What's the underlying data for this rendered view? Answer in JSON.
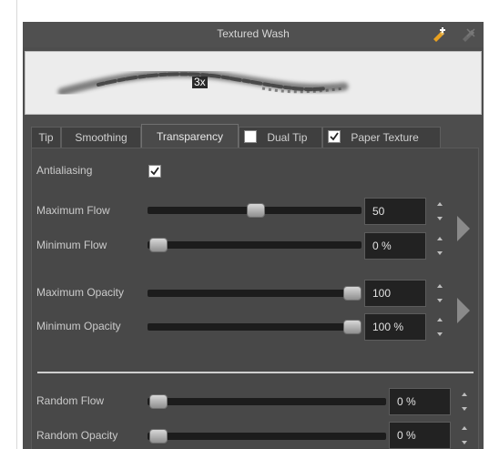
{
  "window": {
    "title": "Textured Wash"
  },
  "preview": {
    "badge": "3x"
  },
  "tabs": [
    {
      "label": "Tip"
    },
    {
      "label": "Smoothing"
    },
    {
      "label": "Transparency"
    },
    {
      "label": "Dual Tip",
      "checked": false
    },
    {
      "label": "Paper Texture",
      "checked": true
    }
  ],
  "antialiasing": {
    "label": "Antialiasing",
    "checked": true
  },
  "sliders": {
    "max_flow": {
      "label": "Maximum Flow",
      "value": "50",
      "fraction": 0.5
    },
    "min_flow": {
      "label": "Minimum Flow",
      "value": "0 %",
      "fraction": 0.0
    },
    "max_opacity": {
      "label": "Maximum Opacity",
      "value": "100",
      "fraction": 1.0
    },
    "min_opacity": {
      "label": "Minimum Opacity",
      "value": "100 %",
      "fraction": 1.0
    },
    "random_flow": {
      "label": "Random Flow",
      "value": "0 %",
      "fraction": 0.0
    },
    "random_opacity": {
      "label": "Random Opacity",
      "value": "0 %",
      "fraction": 0.0
    }
  },
  "icons": {
    "add_preset": "add-preset-icon",
    "delete_preset": "delete-preset-icon"
  },
  "colors": {
    "panel": "#4d4d4d",
    "field": "#222222",
    "track": "#1c1c1c"
  }
}
